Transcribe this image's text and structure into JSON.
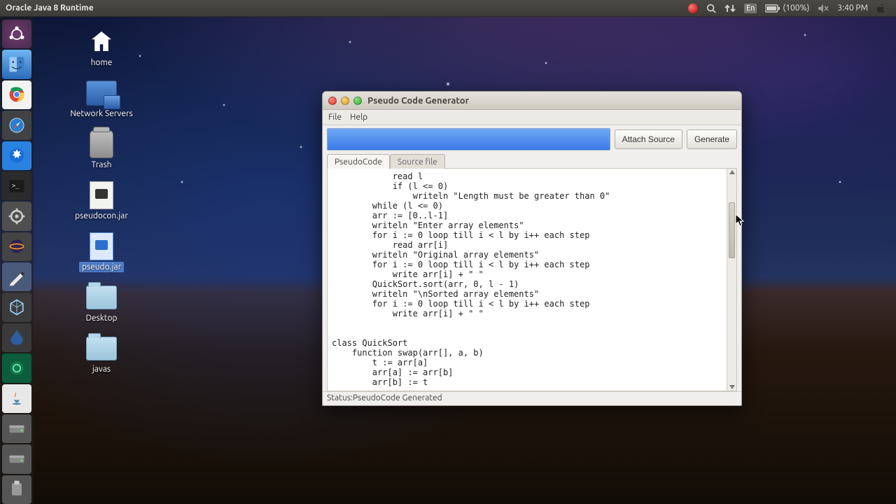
{
  "menubar": {
    "app_title": "Oracle Java 8 Runtime",
    "battery_pct": "(100%)",
    "clock": "3:40 PM",
    "lang": "En"
  },
  "desktop": {
    "icons": [
      {
        "label": "home"
      },
      {
        "label": "Network Servers"
      },
      {
        "label": "Trash"
      },
      {
        "label": "pseudocon.jar"
      },
      {
        "label": "pseudo.jar"
      },
      {
        "label": "Desktop"
      },
      {
        "label": "javas"
      }
    ]
  },
  "app_window": {
    "title": "Pseudo Code Generator",
    "menu": {
      "file": "File",
      "help": "Help"
    },
    "buttons": {
      "attach": "Attach Source",
      "generate": "Generate"
    },
    "tabs": {
      "pseudo": "PseudoCode",
      "source": "Source file"
    },
    "code": "            read l\n            if (l <= 0)\n                writeln \"Length must be greater than 0\"\n        while (l <= 0)\n        arr := [0..l-1]\n        writeln \"Enter array elements\"\n        for i := 0 loop till i < l by i++ each step\n            read arr[i]\n        writeln \"Original array elements\"\n        for i := 0 loop till i < l by i++ each step\n            write arr[i] + \" \"\n        QuickSort.sort(arr, 0, l - 1)\n        writeln \"\\nSorted array elements\"\n        for i := 0 loop till i < l by i++ each step\n            write arr[i] + \" \"\n\n\nclass QuickSort\n    function swap(arr[], a, b)\n        t := arr[a]\n        arr[a] := arr[b]\n        arr[b] := t",
    "status": "Status:PseudoCode Generated"
  }
}
